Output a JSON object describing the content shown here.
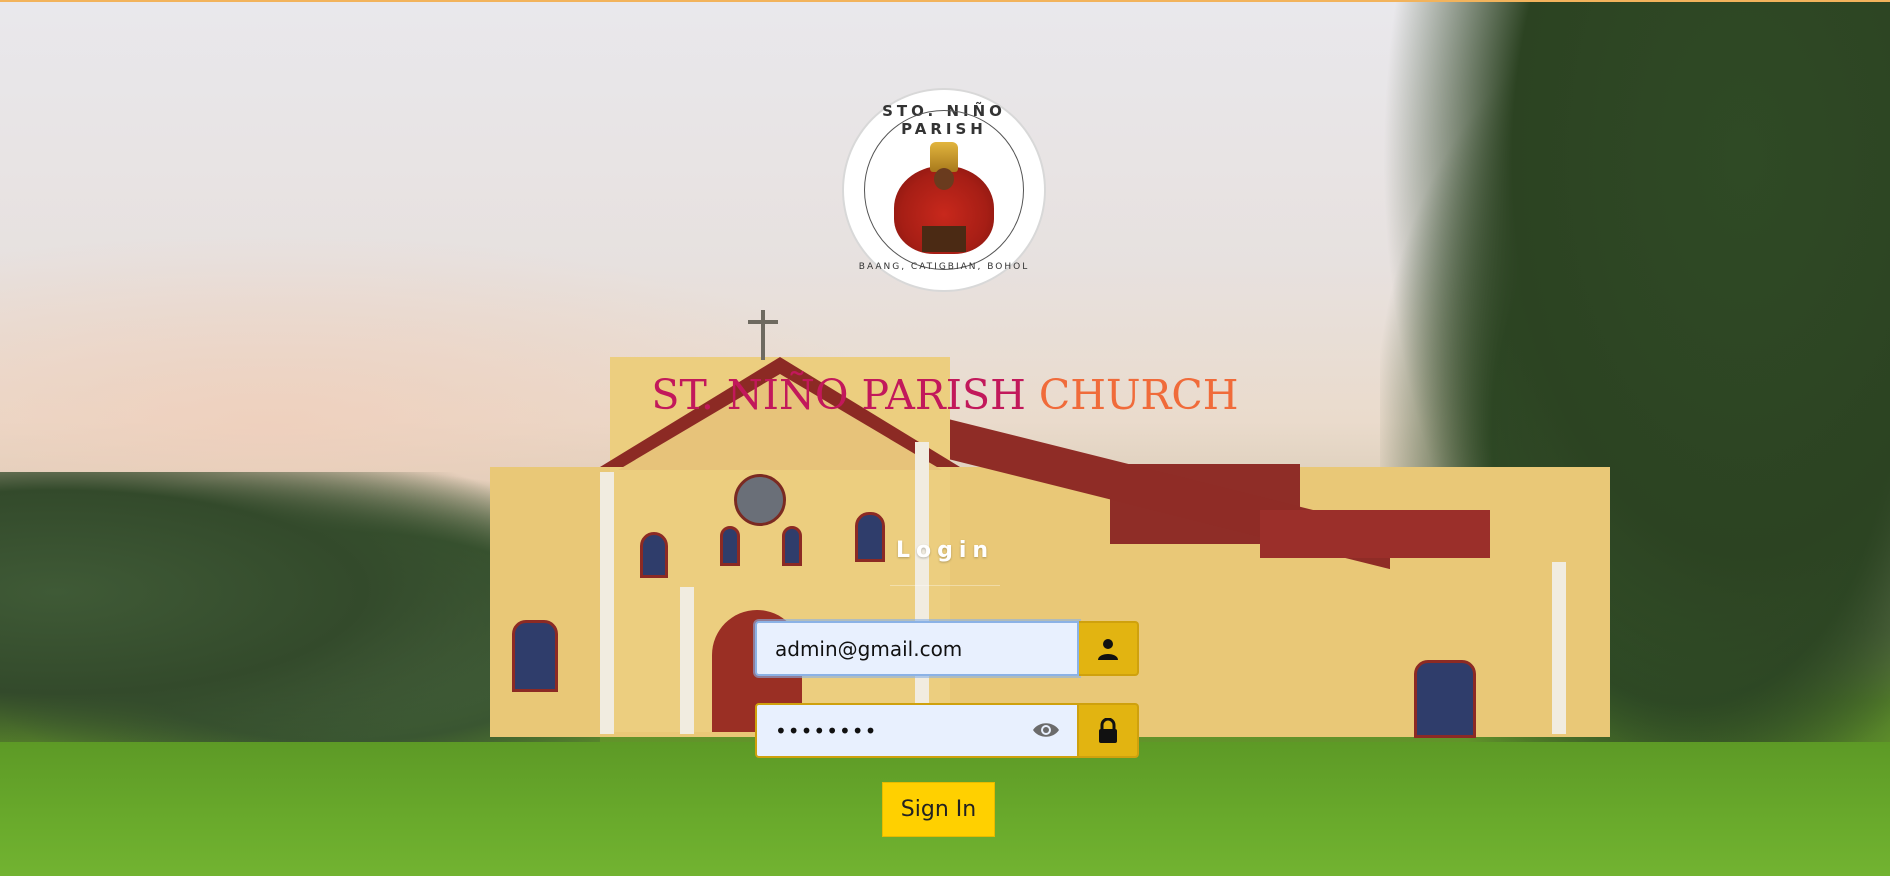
{
  "header": {
    "logo_icon": "parish-seal-icon",
    "logo_text_top": "STO. NIÑO PARISH",
    "logo_text_bottom": "BAANG, CATIGBIAN, BOHOL"
  },
  "title": {
    "part1": "ST. NIÑO PARISH ",
    "part2": "CHURCH",
    "colors": {
      "part1": "#c2185b",
      "part2": "#f06b3a"
    }
  },
  "login": {
    "heading": "Login",
    "email": {
      "value": "admin@gmail.com",
      "icon": "user-icon"
    },
    "password": {
      "value": "••••••••",
      "toggle_icon": "eye-icon",
      "icon": "lock-icon"
    },
    "submit_label": "Sign In",
    "accent": "#e2b411"
  }
}
